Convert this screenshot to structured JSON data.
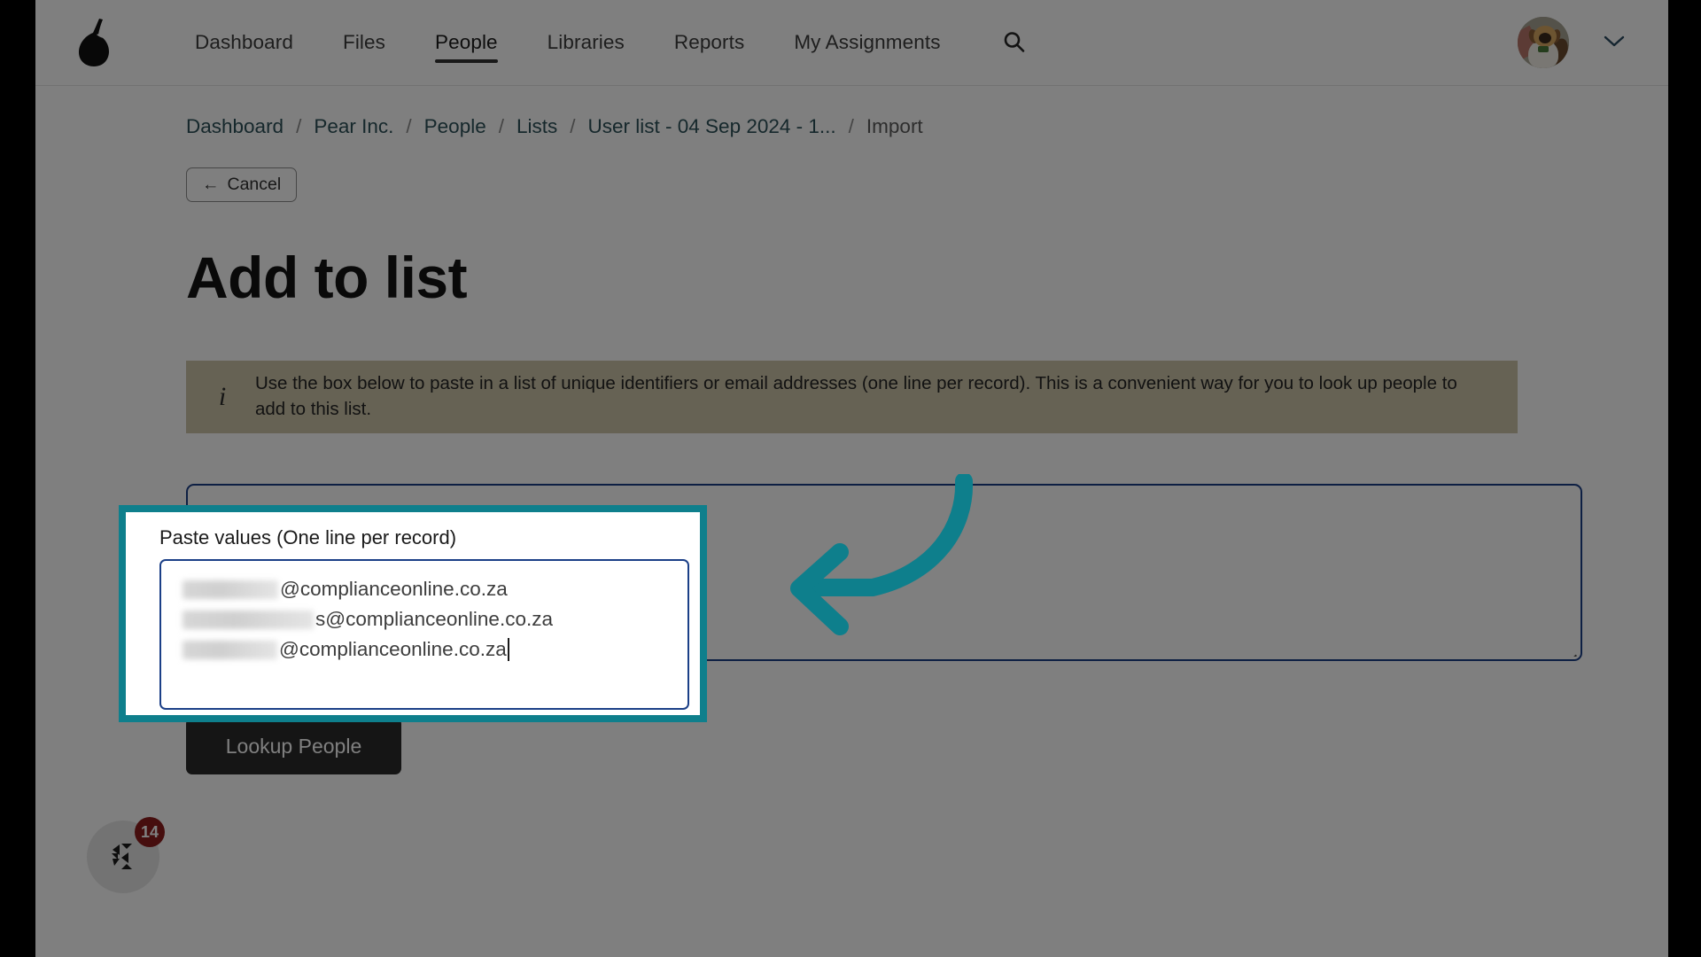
{
  "header": {
    "logo_name": "pear-logo",
    "nav": [
      {
        "label": "Dashboard",
        "active": false
      },
      {
        "label": "Files",
        "active": false
      },
      {
        "label": "People",
        "active": true
      },
      {
        "label": "Libraries",
        "active": false
      },
      {
        "label": "Reports",
        "active": false
      },
      {
        "label": "My Assignments",
        "active": false
      }
    ],
    "search_icon": "search-icon",
    "avatar_alt": "User avatar",
    "chevron_icon": "chevron-down-icon"
  },
  "breadcrumb": {
    "separator": "/",
    "items": [
      {
        "label": "Dashboard",
        "current": false
      },
      {
        "label": "Pear Inc.",
        "current": false
      },
      {
        "label": "People",
        "current": false
      },
      {
        "label": "Lists",
        "current": false
      },
      {
        "label": "User list - 04 Sep 2024 - 1...",
        "current": false
      },
      {
        "label": "Import",
        "current": true
      }
    ]
  },
  "toolbar": {
    "cancel_label": "Cancel",
    "cancel_arrow": "←"
  },
  "page": {
    "title": "Add to list"
  },
  "banner": {
    "icon": "info-icon",
    "icon_glyph": "i",
    "text": "Use the box below to paste in a list of unique identifiers or email addresses (one line per record). This is a convenient way for you to look up people to add to this list."
  },
  "form": {
    "paste_label": "Paste values (One line per record)",
    "textarea_value": "",
    "textarea_placeholder": "",
    "submit_label": "Lookup People"
  },
  "highlight": {
    "label": "Paste values (One line per record)",
    "email_domain": "@complianceonline.co.za",
    "lines": [
      {
        "redacted_width": 108,
        "domain": "@complianceonline.co.za",
        "suffix": ""
      },
      {
        "redacted_width": 148,
        "domain": "@complianceonline.co.za",
        "suffix": "s"
      },
      {
        "redacted_width": 107,
        "domain": "@complianceonline.co.za",
        "suffix": ""
      }
    ],
    "border_color": "#0e7f8c"
  },
  "annotation": {
    "arrow_name": "callout-arrow",
    "arrow_color": "#0e7f8c"
  },
  "chat": {
    "icon": "chat-widget-icon",
    "badge_count": "14",
    "badge_color": "#8c1d1d"
  }
}
